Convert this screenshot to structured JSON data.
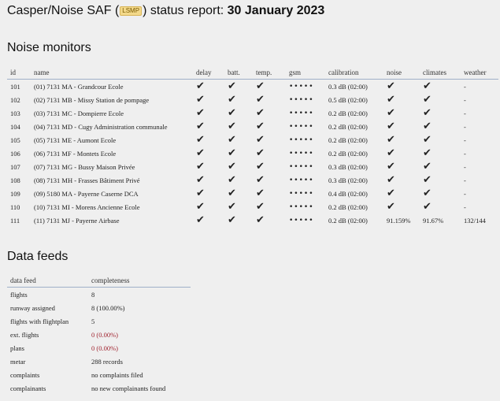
{
  "report": {
    "title_prefix": "Casper/Noise SAF (",
    "badge": "LSMP",
    "title_middle": ") status report: ",
    "date": "30 January 2023"
  },
  "noise_section": {
    "heading": "Noise monitors",
    "columns": [
      "id",
      "name",
      "delay",
      "batt.",
      "temp.",
      "gsm",
      "calibration",
      "noise",
      "climates",
      "weather"
    ],
    "rows": [
      {
        "id": "101",
        "name": "(01) 7131 MA - Grandcour Ecole",
        "delay": "✔",
        "batt": "✔",
        "temp": "✔",
        "gsm": "•••••",
        "calibration": "0.3 dB (02:00)",
        "noise": "✔",
        "climates": "✔",
        "weather": "-"
      },
      {
        "id": "102",
        "name": "(02) 7131 MB - Missy Station de pompage",
        "delay": "✔",
        "batt": "✔",
        "temp": "✔",
        "gsm": "•••••",
        "calibration": "0.5 dB (02:00)",
        "noise": "✔",
        "climates": "✔",
        "weather": "-"
      },
      {
        "id": "103",
        "name": "(03) 7131 MC - Dompierre Ecole",
        "delay": "✔",
        "batt": "✔",
        "temp": "✔",
        "gsm": "•••••",
        "calibration": "0.2 dB (02:00)",
        "noise": "✔",
        "climates": "✔",
        "weather": "-"
      },
      {
        "id": "104",
        "name": "(04) 7131 MD - Cugy Administration communale",
        "delay": "✔",
        "batt": "✔",
        "temp": "✔",
        "gsm": "•••••",
        "calibration": "0.2 dB (02:00)",
        "noise": "✔",
        "climates": "✔",
        "weather": "-"
      },
      {
        "id": "105",
        "name": "(05) 7131 ME - Aumont Ecole",
        "delay": "✔",
        "batt": "✔",
        "temp": "✔",
        "gsm": "•••••",
        "calibration": "0.2 dB (02:00)",
        "noise": "✔",
        "climates": "✔",
        "weather": "-"
      },
      {
        "id": "106",
        "name": "(06) 7131 MF - Montets Ecole",
        "delay": "✔",
        "batt": "✔",
        "temp": "✔",
        "gsm": "•••••",
        "calibration": "0.2 dB (02:00)",
        "noise": "✔",
        "climates": "✔",
        "weather": "-"
      },
      {
        "id": "107",
        "name": "(07) 7131 MG - Bussy Maison Privée",
        "delay": "✔",
        "batt": "✔",
        "temp": "✔",
        "gsm": "•••••",
        "calibration": "0.3 dB (02:00)",
        "noise": "✔",
        "climates": "✔",
        "weather": "-"
      },
      {
        "id": "108",
        "name": "(08) 7131 MH - Frasses Bâtiment Privé",
        "delay": "✔",
        "batt": "✔",
        "temp": "✔",
        "gsm": "•••••",
        "calibration": "0.3 dB (02:00)",
        "noise": "✔",
        "climates": "✔",
        "weather": "-"
      },
      {
        "id": "109",
        "name": "(09) 5180 MA - Payerne Caserne DCA",
        "delay": "✔",
        "batt": "✔",
        "temp": "✔",
        "gsm": "•••••",
        "calibration": "0.4 dB (02:00)",
        "noise": "✔",
        "climates": "✔",
        "weather": "-"
      },
      {
        "id": "110",
        "name": "(10) 7131 MI - Morens Ancienne Ecole",
        "delay": "✔",
        "batt": "✔",
        "temp": "✔",
        "gsm": "•••••",
        "calibration": "0.2 dB (02:00)",
        "noise": "✔",
        "climates": "✔",
        "weather": "-"
      },
      {
        "id": "111",
        "name": "(11) 7131 MJ - Payerne Airbase",
        "delay": "✔",
        "batt": "✔",
        "temp": "✔",
        "gsm": "•••••",
        "calibration": "0.2 dB (02:00)",
        "noise": "91.159%",
        "climates": "91.67%",
        "weather": "132/144"
      }
    ]
  },
  "feeds_section": {
    "heading": "Data feeds",
    "columns": [
      "data feed",
      "completeness"
    ],
    "rows": [
      {
        "feed": "flights",
        "value": "8",
        "status": "ok"
      },
      {
        "feed": "runway assigned",
        "value": "8 (100.00%)",
        "status": "ok"
      },
      {
        "feed": "flights with flightplan",
        "value": "5",
        "status": "ok"
      },
      {
        "feed": "ext. flights",
        "value": "0 (0.00%)",
        "status": "bad"
      },
      {
        "feed": "plans",
        "value": "0 (0.00%)",
        "status": "bad"
      },
      {
        "feed": "metar",
        "value": "288 records",
        "status": "ok"
      },
      {
        "feed": "complaints",
        "value": "no complaints filed",
        "status": "ok"
      },
      {
        "feed": "complainants",
        "value": "no new complainants found",
        "status": "ok"
      }
    ]
  },
  "colors": {
    "warning": "#b8752a",
    "alert": "#a0232f",
    "header_rule": "#9fb0c8"
  }
}
